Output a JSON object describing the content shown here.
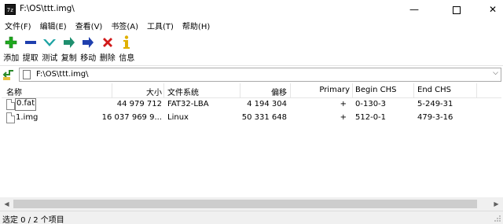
{
  "window": {
    "title": "F:\\OS\\ttt.img\\",
    "app_icon_text": "7z",
    "minimize_glyph": "—",
    "close_glyph": "✕"
  },
  "menu": [
    {
      "label": "文件(F)"
    },
    {
      "label": "编辑(E)"
    },
    {
      "label": "查看(V)"
    },
    {
      "label": "书签(A)"
    },
    {
      "label": "工具(T)"
    },
    {
      "label": "帮助(H)"
    }
  ],
  "toolbar": [
    {
      "label": "添加",
      "icon": "add-icon",
      "color": "#1faa1f"
    },
    {
      "label": "提取",
      "icon": "extract-icon",
      "color": "#1f3fae"
    },
    {
      "label": "测试",
      "icon": "test-icon",
      "color": "#1ea3a3"
    },
    {
      "label": "复制",
      "icon": "copy-icon",
      "color": "#1f8f6f"
    },
    {
      "label": "移动",
      "icon": "move-icon",
      "color": "#1f3fae"
    },
    {
      "label": "删除",
      "icon": "delete-icon",
      "color": "#d11a1a"
    },
    {
      "label": "信息",
      "icon": "info-icon",
      "color": "#e0b000"
    }
  ],
  "address": {
    "path": "F:\\OS\\ttt.img\\",
    "dropdown_glyph": "⌵"
  },
  "columns": [
    {
      "label": "名称"
    },
    {
      "label": "大小"
    },
    {
      "label": "文件系统"
    },
    {
      "label": "偏移"
    },
    {
      "label": "Primary"
    },
    {
      "label": "Begin CHS"
    },
    {
      "label": "End CHS"
    }
  ],
  "rows": [
    {
      "name": "0.fat",
      "size": "44 979 712",
      "fs": "FAT32-LBA",
      "offset": "4 194 304",
      "primary": "+",
      "begin": "0-130-3",
      "end": "5-249-31"
    },
    {
      "name": "1.img",
      "size": "16 037 969 9...",
      "fs": "Linux",
      "offset": "50 331 648",
      "primary": "+",
      "begin": "512-0-1",
      "end": "479-3-16"
    }
  ],
  "scrollbar": {
    "left_glyph": "◀",
    "right_glyph": "▶"
  },
  "status": {
    "text": "选定 0 / 2 个项目"
  }
}
